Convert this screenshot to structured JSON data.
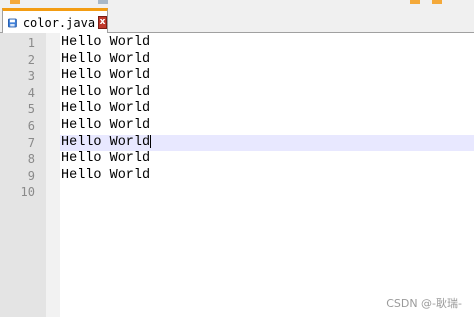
{
  "tab": {
    "label": "color.java",
    "close_glyph": "x"
  },
  "editor": {
    "current_line_index": 6,
    "line_numbers": [
      "1",
      "2",
      "3",
      "4",
      "5",
      "6",
      "7",
      "8",
      "9",
      "10"
    ],
    "lines": [
      "Hello World",
      "Hello World",
      "Hello World",
      "Hello World",
      "Hello World",
      "Hello World",
      "Hello World",
      "Hello World",
      "Hello World",
      ""
    ]
  },
  "watermark": "CSDN @-耿瑞-",
  "colors": {
    "current_line": "#e8e8ff",
    "tab_accent": "#f39c12",
    "close_button": "#c0392b",
    "gutter": "#e4e4e4"
  },
  "icons": {
    "tab_file": "save-disk-icon",
    "tab_close": "close-icon"
  }
}
